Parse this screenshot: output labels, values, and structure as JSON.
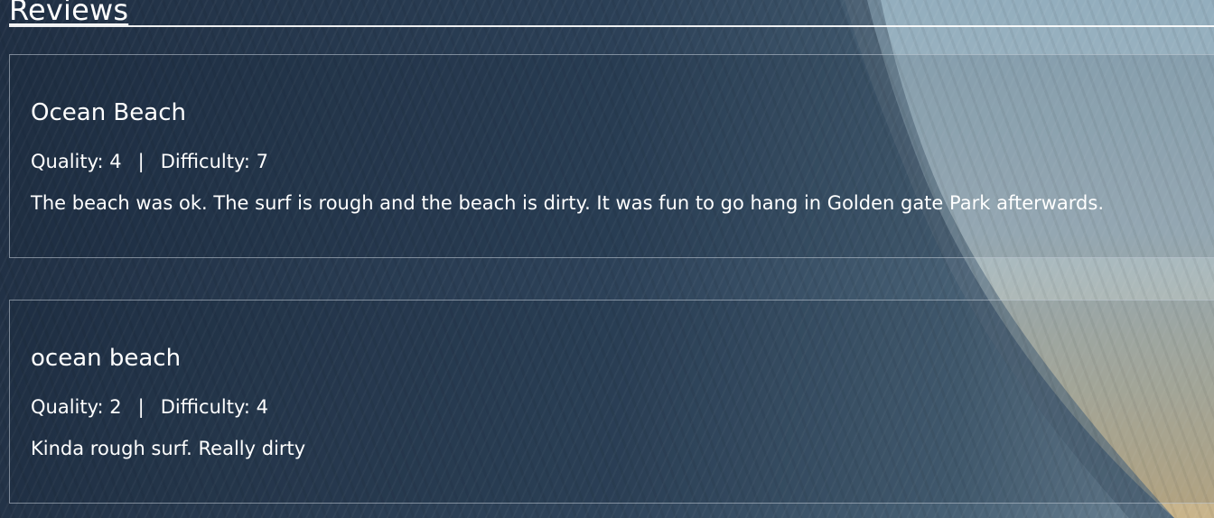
{
  "page": {
    "heading": "Reviews"
  },
  "reviews": [
    {
      "title": "Ocean Beach",
      "quality_label": "Quality:",
      "quality": "4",
      "separator": "|",
      "difficulty_label": "Difficulty:",
      "difficulty": "7",
      "text": "The beach was ok. The surf is rough and the beach is dirty. It was fun to go hang in Golden gate Park afterwards."
    },
    {
      "title": "ocean beach",
      "quality_label": "Quality:",
      "quality": "2",
      "separator": "|",
      "difficulty_label": "Difficulty:",
      "difficulty": "4",
      "text": "Kinda rough surf. Really dirty"
    }
  ],
  "colors": {
    "text": "#ffffff",
    "card_border": "#c8d2dc",
    "wave_dark": "#23344a",
    "sky": "#a9bcc8"
  }
}
